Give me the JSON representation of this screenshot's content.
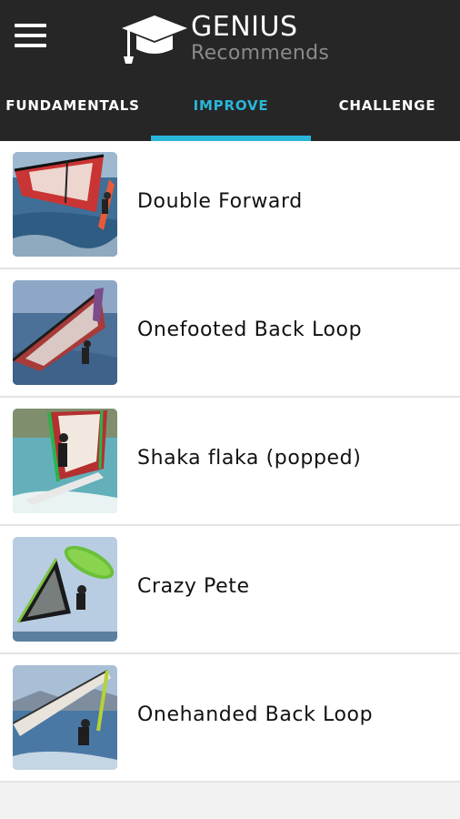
{
  "header": {
    "brand": "GENIUS",
    "subtitle": "Recommends"
  },
  "tabs": [
    {
      "label": "FUNDAMENTALS",
      "active": false
    },
    {
      "label": "IMPROVE",
      "active": true
    },
    {
      "label": "CHALLENGE",
      "active": false
    }
  ],
  "colors": {
    "topbar": "#262626",
    "accent": "#29b6d8",
    "list_background": "#ffffff",
    "page_background": "#f2f2f2"
  },
  "moves": [
    {
      "label": "Double Forward",
      "thumbnail": "windsurfer-red-sail-photo"
    },
    {
      "label": "Onefooted Back Loop",
      "thumbnail": "windsurfer-red-sail-photo"
    },
    {
      "label": "Shaka flaka (popped)",
      "thumbnail": "windsurfer-green-sail-photo"
    },
    {
      "label": "Crazy Pete",
      "thumbnail": "windsurfer-green-board-photo"
    },
    {
      "label": "Onehanded Back Loop",
      "thumbnail": "windsurfer-white-sail-photo"
    }
  ]
}
